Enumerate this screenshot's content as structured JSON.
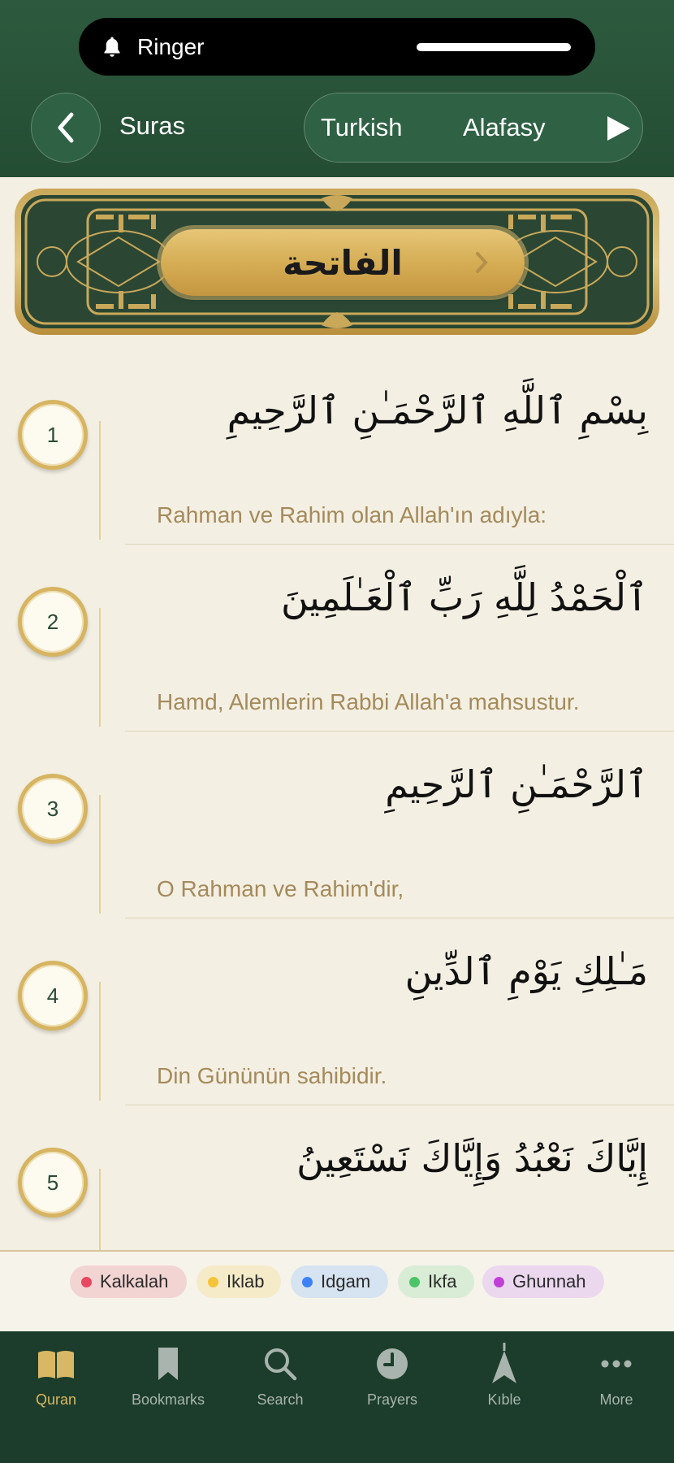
{
  "status": {
    "ringer_label": "Ringer"
  },
  "header": {
    "back_icon": "chevron-left-icon",
    "title": "Suras",
    "language": "Turkish",
    "reciter": "Alafasy",
    "play_icon": "play-icon"
  },
  "banner": {
    "sura_name": "الفاتحة"
  },
  "ayahs": [
    {
      "number": "1",
      "arabic": "بِسْمِ ٱللَّهِ ٱلرَّحْمَـٰنِ ٱلرَّحِيمِ",
      "translation": "Rahman ve Rahim olan Allah'ın adıyla:"
    },
    {
      "number": "2",
      "arabic": "ٱلْحَمْدُ لِلَّهِ رَبِّ ٱلْعَـٰلَمِينَ",
      "translation": "Hamd, Alemlerin Rabbi Allah'a mahsustur."
    },
    {
      "number": "3",
      "arabic": "ٱلرَّحْمَـٰنِ ٱلرَّحِيمِ",
      "translation": "O Rahman ve Rahim'dir,"
    },
    {
      "number": "4",
      "arabic": "مَـٰلِكِ يَوْمِ ٱلدِّينِ",
      "translation": "Din Gününün sahibidir."
    },
    {
      "number": "5",
      "arabic": "إِيَّاكَ نَعْبُدُ وَإِيَّاكَ نَسْتَعِينُ",
      "translation": ""
    }
  ],
  "tajweed_legend": [
    {
      "label": "Kalkalah",
      "color": "#e8475f",
      "bg": "#f2d4d3"
    },
    {
      "label": "Iklab",
      "color": "#f4c53a",
      "bg": "#f5ebc9"
    },
    {
      "label": "Idgam",
      "color": "#3b82f6",
      "bg": "#d6e3f0"
    },
    {
      "label": "Ikfa",
      "color": "#4cc467",
      "bg": "#d9ecd6"
    },
    {
      "label": "Ghunnah",
      "color": "#c03fd6",
      "bg": "#ebd8ef"
    }
  ],
  "tabs": [
    {
      "label": "Quran",
      "icon": "book-icon",
      "active": true
    },
    {
      "label": "Bookmarks",
      "icon": "bookmark-icon",
      "active": false
    },
    {
      "label": "Search",
      "icon": "search-icon",
      "active": false
    },
    {
      "label": "Prayers",
      "icon": "clock-icon",
      "active": false
    },
    {
      "label": "Kıble",
      "icon": "compass-needle-icon",
      "active": false
    },
    {
      "label": "More",
      "icon": "more-icon",
      "active": false
    }
  ],
  "colors": {
    "header_green": "#2d5a3e",
    "tab_bar": "#1c3d2b",
    "gold": "#d6b461",
    "translation": "#a58a5a",
    "background": "#f3efe3"
  }
}
